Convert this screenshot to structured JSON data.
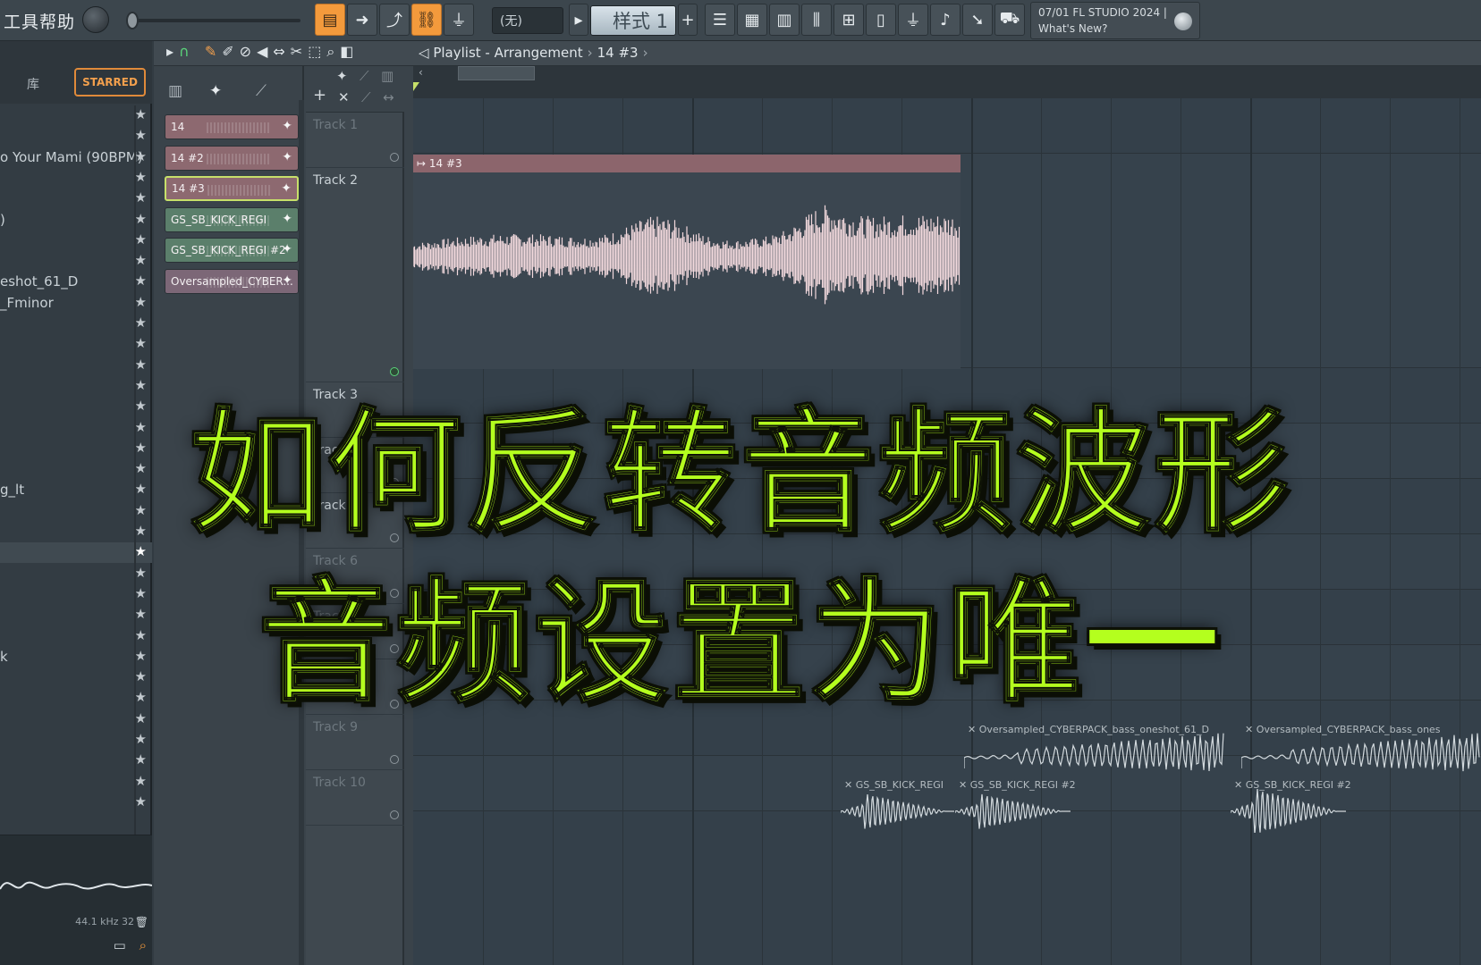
{
  "menu": {
    "tools": "工具",
    "help": "帮助"
  },
  "toolbar": {
    "pattern_none": "(无)",
    "pattern_name": "样式 1",
    "add_symbol": "+",
    "news_line1": "07/01  FL STUDIO 2024 |",
    "news_line2": "What's New?"
  },
  "browser": {
    "tab_library": "库",
    "tab_starred": "STARRED",
    "items": [
      {
        "label": ""
      },
      {
        "label": ""
      },
      {
        "label": "o Your Mami (90BPM)"
      },
      {
        "label": ""
      },
      {
        "label": ""
      },
      {
        "label": ")"
      },
      {
        "label": ""
      },
      {
        "label": ""
      },
      {
        "label": "eshot_61_D"
      },
      {
        "label": "_Fminor"
      },
      {
        "label": ""
      },
      {
        "label": ""
      },
      {
        "label": ""
      },
      {
        "label": ""
      },
      {
        "label": ""
      },
      {
        "label": ""
      },
      {
        "label": ""
      },
      {
        "label": ""
      },
      {
        "label": "g_lt"
      },
      {
        "label": ""
      },
      {
        "label": ""
      },
      {
        "label": ""
      },
      {
        "label": ""
      },
      {
        "label": ""
      },
      {
        "label": ""
      },
      {
        "label": ""
      },
      {
        "label": "k"
      },
      {
        "label": ""
      },
      {
        "label": ""
      },
      {
        "label": ""
      },
      {
        "label": ""
      },
      {
        "label": ""
      },
      {
        "label": ""
      },
      {
        "label": ""
      }
    ],
    "freq": "44.1 kHz 32"
  },
  "playlist": {
    "title": "Playlist - Arrangement",
    "current_pattern": "14 #3",
    "clips": [
      {
        "name": "14",
        "style": "audio"
      },
      {
        "name": "14 #2",
        "style": "audio2"
      },
      {
        "name": "14 #3",
        "style": "audio sel"
      },
      {
        "name": "GS_SB_KICK_REGI",
        "style": "green"
      },
      {
        "name": "GS_SB_KICK_REGI #2",
        "style": "green"
      },
      {
        "name": "Oversampled_CYBER...",
        "style": "purple"
      }
    ],
    "tracks": [
      {
        "name": "Track 1"
      },
      {
        "name": "Track 2"
      },
      {
        "name": "Track 3"
      },
      {
        "name": "Track 4"
      },
      {
        "name": "Track 5"
      },
      {
        "name": "Track 6"
      },
      {
        "name": "Track 7"
      },
      {
        "name": "Track 8"
      },
      {
        "name": "Track 9"
      },
      {
        "name": "Track 10"
      }
    ],
    "arrangement_clips": {
      "big": "14 #3",
      "cyber1": "Oversampled_CYBERPACK_bass_oneshot_61_D",
      "cyber2": "Oversampled_CYBERPACK_bass_ones",
      "kick1": "GS_SB_KICK_REGI",
      "kick2": "GS_SB_KICK_REGI #2",
      "kick3": "GS_SB_KICK_REGI #2"
    }
  },
  "overlay": {
    "line1": "如何反转音频波形",
    "line2": "音频设置为唯一"
  },
  "colors": {
    "accent": "#b4ff1e",
    "orange": "#f39a3c",
    "clip_audio": "#8d6970",
    "waveform": "#f2d9dd"
  }
}
